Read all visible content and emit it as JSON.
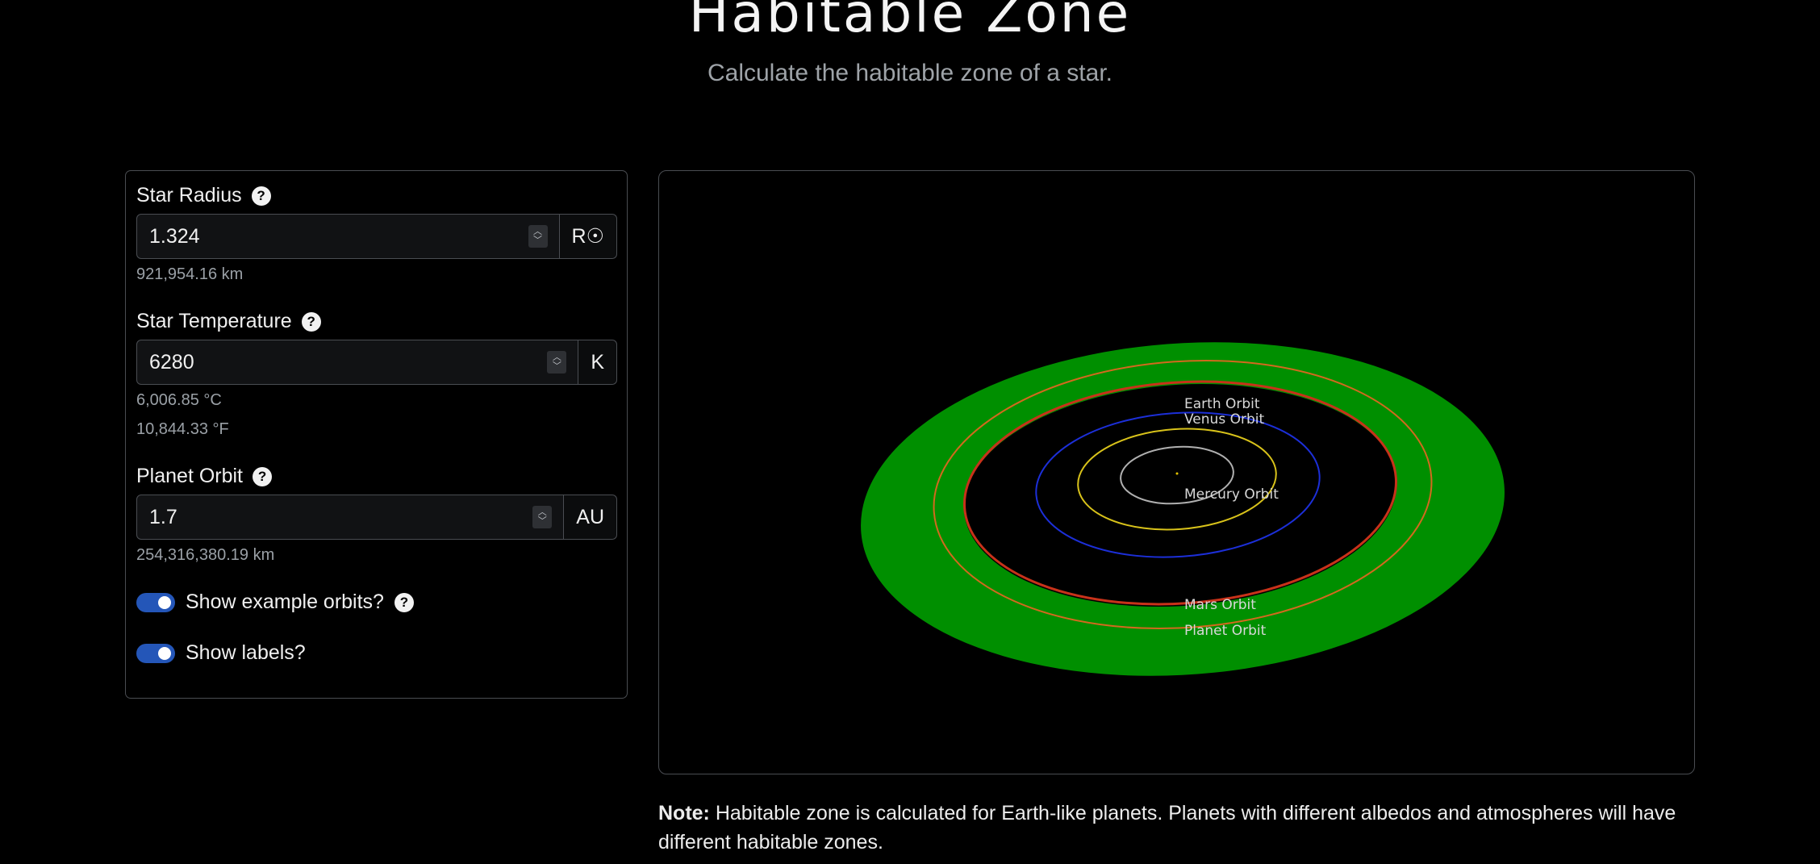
{
  "header": {
    "title": "Habitable Zone",
    "subtitle": "Calculate the habitable zone of a star."
  },
  "form": {
    "star_radius": {
      "label": "Star Radius",
      "value": "1.324",
      "unit": "R☉",
      "conversions": [
        "921,954.16 km"
      ]
    },
    "star_temperature": {
      "label": "Star Temperature",
      "value": "6280",
      "unit": "K",
      "conversions": [
        "6,006.85 °C",
        "10,844.33 °F"
      ]
    },
    "planet_orbit": {
      "label": "Planet Orbit",
      "value": "1.7",
      "unit": "AU",
      "conversions": [
        "254,316,380.19 km"
      ]
    },
    "toggles": {
      "show_example_orbits": {
        "label": "Show example orbits?",
        "on": true
      },
      "show_labels": {
        "label": "Show labels?",
        "on": true
      }
    },
    "help_glyph": "?"
  },
  "visualization": {
    "habitable_zone_color": "#008f00",
    "orbit_labels": {
      "earth": "Earth Orbit",
      "venus": "Venus Orbit",
      "mercury": "Mercury Orbit",
      "mars": "Mars Orbit",
      "planet": "Planet Orbit"
    },
    "orbit_colors": {
      "mercury": "#b0b0b0",
      "venus": "#d8c21a",
      "earth": "#1c2fd8",
      "mars": "#c8321a",
      "planet": "#d2691e"
    }
  },
  "note": {
    "prefix": "Note:",
    "text": " Habitable zone is calculated for Earth-like planets. Planets with different albedos and atmospheres will have different habitable zones."
  }
}
